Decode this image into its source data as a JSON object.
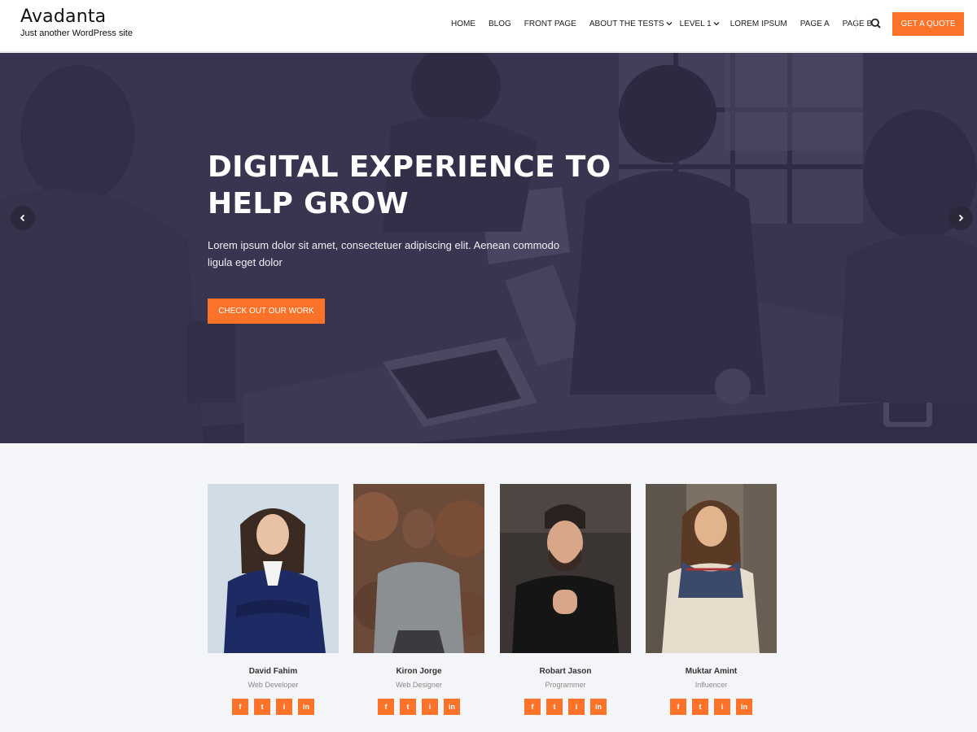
{
  "brand": {
    "title": "Avadanta",
    "tagline": "Just another WordPress site"
  },
  "nav": {
    "items": [
      {
        "label": "HOME",
        "has_dropdown": false
      },
      {
        "label": "BLOG",
        "has_dropdown": false
      },
      {
        "label": "FRONT PAGE",
        "has_dropdown": false
      },
      {
        "label": "ABOUT THE TESTS",
        "has_dropdown": true
      },
      {
        "label": "LEVEL 1",
        "has_dropdown": true
      },
      {
        "label": "LOREM IPSUM",
        "has_dropdown": false
      },
      {
        "label": "PAGE A",
        "has_dropdown": false
      },
      {
        "label": "PAGE B",
        "has_dropdown": false
      }
    ],
    "search_icon": "search-icon",
    "quote_button": "GET A QUOTE"
  },
  "hero": {
    "title_line1": "DIGITAL EXPERIENCE TO",
    "title_line2": "HELP GROW",
    "text": "Lorem ipsum dolor sit amet, consectetuer adipiscing elit. Aenean commodo ligula eget dolor",
    "cta": "CHECK OUT OUR WORK",
    "prev_icon": "chevron-left-icon",
    "next_icon": "chevron-right-icon"
  },
  "team": [
    {
      "name": "David Fahim",
      "role": "Web Developer"
    },
    {
      "name": "Kiron Jorge",
      "role": "Web Designer"
    },
    {
      "name": "Robart Jason",
      "role": "Programmer"
    },
    {
      "name": "Muktar Amint",
      "role": "Influencer"
    }
  ],
  "social": {
    "facebook": "f",
    "twitter": "t",
    "instagram": "i",
    "linkedin": "in"
  },
  "colors": {
    "accent": "#fd7229",
    "hero_overlay": "#3a3853",
    "section_bg": "#f4f5f8"
  }
}
